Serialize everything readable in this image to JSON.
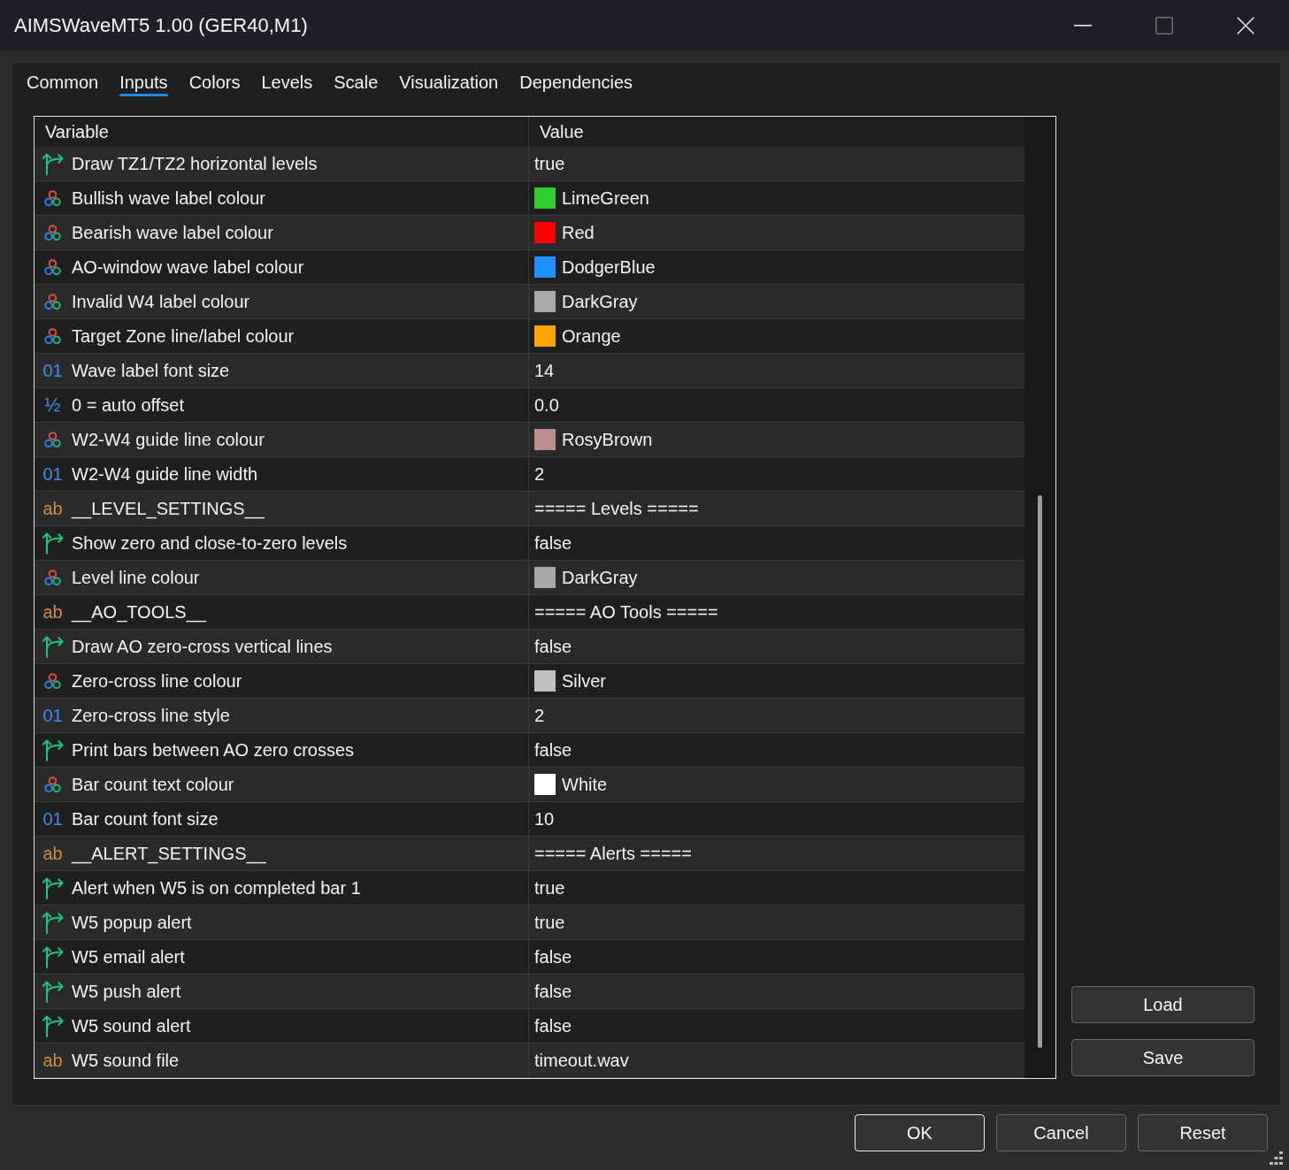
{
  "window": {
    "title": "AIMSWaveMT5 1.00 (GER40,M1)"
  },
  "tabs": [
    {
      "label": "Common",
      "selected": false
    },
    {
      "label": "Inputs",
      "selected": true
    },
    {
      "label": "Colors",
      "selected": false
    },
    {
      "label": "Levels",
      "selected": false
    },
    {
      "label": "Scale",
      "selected": false
    },
    {
      "label": "Visualization",
      "selected": false
    },
    {
      "label": "Dependencies",
      "selected": false
    }
  ],
  "table": {
    "columns": [
      "Variable",
      "Value"
    ],
    "rows": [
      {
        "kind": "bool",
        "variable": "Draw TZ1/TZ2 horizontal levels",
        "value": "true"
      },
      {
        "kind": "color",
        "variable": "Bullish wave label colour",
        "value": "LimeGreen",
        "color": "#32cd32"
      },
      {
        "kind": "color",
        "variable": "Bearish wave label colour",
        "value": "Red",
        "color": "#ff0000"
      },
      {
        "kind": "color",
        "variable": "AO-window wave label colour",
        "value": "DodgerBlue",
        "color": "#1e90ff"
      },
      {
        "kind": "color",
        "variable": "Invalid W4 label colour",
        "value": "DarkGray",
        "color": "#a9a9a9"
      },
      {
        "kind": "color",
        "variable": "Target Zone line/label colour",
        "value": "Orange",
        "color": "#ffa500"
      },
      {
        "kind": "int",
        "type_icon": "01",
        "variable": "Wave label font size",
        "value": "14"
      },
      {
        "kind": "double",
        "type_icon": "½",
        "variable": "0 = auto offset",
        "value": "0.0"
      },
      {
        "kind": "color",
        "variable": "W2-W4 guide line colour",
        "value": "RosyBrown",
        "color": "#bc8f8f"
      },
      {
        "kind": "int",
        "type_icon": "01",
        "variable": "W2-W4 guide line width",
        "value": "2"
      },
      {
        "kind": "string",
        "type_icon": "ab",
        "variable": "__LEVEL_SETTINGS__",
        "value": "===== Levels ====="
      },
      {
        "kind": "bool",
        "variable": "Show zero and close-to-zero levels",
        "value": "false"
      },
      {
        "kind": "color",
        "variable": "Level line colour",
        "value": "DarkGray",
        "color": "#a9a9a9"
      },
      {
        "kind": "string",
        "type_icon": "ab",
        "variable": "__AO_TOOLS__",
        "value": "===== AO Tools ====="
      },
      {
        "kind": "bool",
        "variable": "Draw AO zero-cross vertical lines",
        "value": "false"
      },
      {
        "kind": "color",
        "variable": "Zero-cross line colour",
        "value": "Silver",
        "color": "#c0c0c0"
      },
      {
        "kind": "int",
        "type_icon": "01",
        "variable": "Zero-cross line style",
        "value": "2"
      },
      {
        "kind": "bool",
        "variable": "Print bars between AO zero crosses",
        "value": "false"
      },
      {
        "kind": "color",
        "variable": "Bar count text colour",
        "value": "White",
        "color": "#ffffff"
      },
      {
        "kind": "int",
        "type_icon": "01",
        "variable": "Bar count font size",
        "value": "10"
      },
      {
        "kind": "string",
        "type_icon": "ab",
        "variable": "__ALERT_SETTINGS__",
        "value": "===== Alerts ====="
      },
      {
        "kind": "bool",
        "variable": "Alert when W5 is on completed bar 1",
        "value": "true"
      },
      {
        "kind": "bool",
        "variable": "W5 popup alert",
        "value": "true"
      },
      {
        "kind": "bool",
        "variable": "W5 email alert",
        "value": "false"
      },
      {
        "kind": "bool",
        "variable": "W5 push alert",
        "value": "false"
      },
      {
        "kind": "bool",
        "variable": "W5 sound alert",
        "value": "false"
      },
      {
        "kind": "string",
        "type_icon": "ab",
        "variable": "W5 sound file",
        "value": "timeout.wav"
      }
    ]
  },
  "side_buttons": [
    "Load",
    "Save"
  ],
  "footer_buttons": [
    {
      "label": "OK",
      "focused": true
    },
    {
      "label": "Cancel",
      "focused": false
    },
    {
      "label": "Reset",
      "focused": false
    }
  ]
}
